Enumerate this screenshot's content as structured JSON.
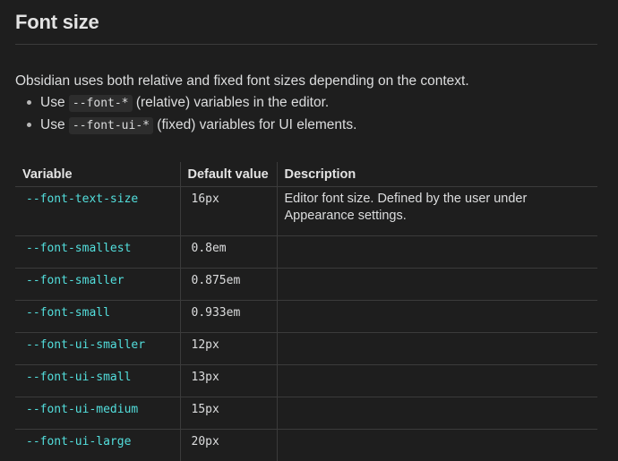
{
  "heading": "Font size",
  "intro": "Obsidian uses both relative and fixed font sizes depending on the context.",
  "bullets": [
    {
      "prefix": "Use",
      "code": "--font-*",
      "suffix": "(relative) variables in the editor."
    },
    {
      "prefix": "Use",
      "code": "--font-ui-*",
      "suffix": "(fixed) variables for UI elements."
    }
  ],
  "table": {
    "headers": [
      "Variable",
      "Default value",
      "Description"
    ],
    "rows": [
      {
        "variable": "--font-text-size",
        "default": "16px",
        "description": "Editor font size. Defined by the user under Appearance settings."
      },
      {
        "variable": "--font-smallest",
        "default": "0.8em",
        "description": ""
      },
      {
        "variable": "--font-smaller",
        "default": "0.875em",
        "description": ""
      },
      {
        "variable": "--font-small",
        "default": "0.933em",
        "description": ""
      },
      {
        "variable": "--font-ui-smaller",
        "default": "12px",
        "description": ""
      },
      {
        "variable": "--font-ui-small",
        "default": "13px",
        "description": ""
      },
      {
        "variable": "--font-ui-medium",
        "default": "15px",
        "description": ""
      },
      {
        "variable": "--font-ui-large",
        "default": "20px",
        "description": ""
      }
    ]
  },
  "colors": {
    "background": "#1e1e1e",
    "text": "#dcddde",
    "variable_accent": "#53dfdd",
    "border": "#3b3b3b",
    "code_background": "#2d2d2d"
  }
}
